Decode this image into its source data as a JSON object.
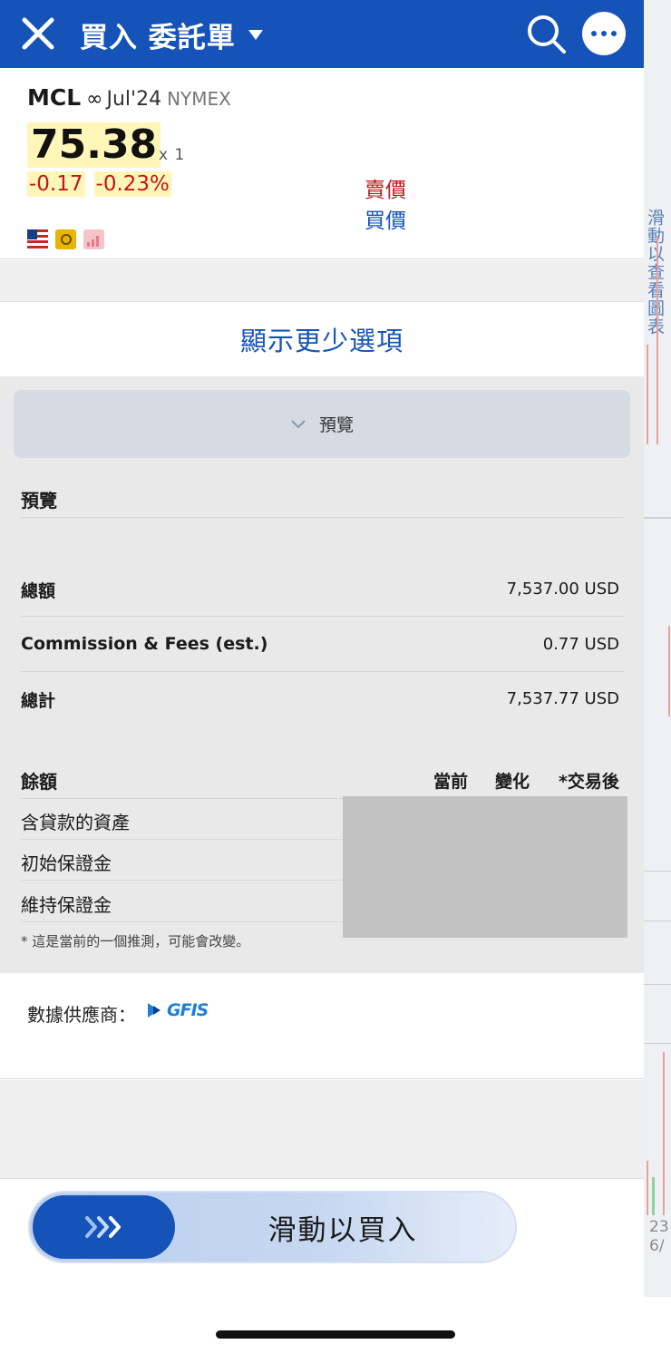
{
  "header": {
    "title": "買入 委託單",
    "close_icon": "close-icon",
    "search_icon": "search-icon",
    "more_icon": "more-options-icon",
    "color": "#1553b9"
  },
  "quote": {
    "symbol": "MCL",
    "continuous_mark": "∞",
    "contract": "Jul'24",
    "exchange": "NYMEX",
    "last_price": "75.38",
    "size": "x 1",
    "change": "-0.17",
    "change_pct": "-0.23%",
    "ask_label": "賣價",
    "bid_label": "買價",
    "badges": [
      "us-flag-icon",
      "clock-icon",
      "chart-badge-icon"
    ]
  },
  "options_toggle": "顯示更少選項",
  "preview": {
    "toggle_label": "預覽",
    "section_title": "預覽",
    "rows": [
      {
        "label": "總額",
        "value": "7,537.00 USD"
      },
      {
        "label": "Commission & Fees (est.)",
        "value": "0.77 USD"
      },
      {
        "label": "總計",
        "value": "7,537.77 USD"
      }
    ],
    "balances": {
      "title": "餘額",
      "columns": [
        "當前",
        "變化",
        "*交易後"
      ],
      "items": [
        "含貸款的資產",
        "初始保證金",
        "維持保證金"
      ],
      "footnote": "* 這是當前的一個推測，可能會改變。"
    }
  },
  "provider": {
    "label": "數據供應商：",
    "logo_text": "GFIS"
  },
  "slider": {
    "label": "滑動以買入"
  },
  "side_panel": {
    "label": "滑動以查看圖表",
    "arrow": "〈",
    "axis_labels": [
      "23",
      "6/"
    ]
  }
}
